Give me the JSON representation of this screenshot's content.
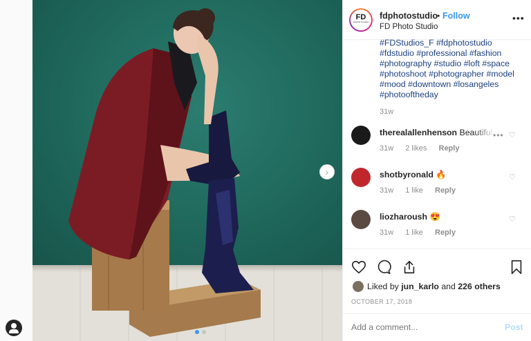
{
  "post": {
    "username": "fdphotostudio",
    "separator": "•",
    "follow_label": "Follow",
    "full_name": "FD Photo Studio",
    "logo_text": "FD",
    "logo_sub": "PHOTO STUDIO",
    "more_label": "•••",
    "caption_lines": [
      "#FDStudios_F #fdphotostudio",
      "#fdstudio #professional #fashion",
      "#photography #studio #loft #space",
      "#photoshoot #photographer #model",
      "#mood #downtown #losangeles",
      "#photooftheday"
    ],
    "caption_time": "31w",
    "next_arrow": "›"
  },
  "comments": [
    {
      "user": "therealallenhenson",
      "text": "Beautiful",
      "time": "31w",
      "likes": "2 likes",
      "reply": "Reply"
    },
    {
      "user": "shotbyronald",
      "text": "🔥",
      "time": "31w",
      "likes": "1 like",
      "reply": "Reply"
    },
    {
      "user": "liozharoush",
      "text": "😍",
      "time": "31w",
      "likes": "1 like",
      "reply": "Reply"
    }
  ],
  "actions": {
    "liked_by_prefix": "Liked by",
    "liked_by_user": "jun_karlo",
    "and": "and",
    "others": "226 others",
    "date": "OCTOBER 17, 2018",
    "add_comment_placeholder": "Add a comment...",
    "post_label": "Post"
  },
  "comment_more": "•••",
  "heart_glyph": "♡",
  "colors": {
    "accent": "#3897f0",
    "post_disabled": "#b3dbff",
    "hashtag": "#1b3f80",
    "wall": "#206a5f",
    "coat": "#7b1c24"
  },
  "icons": [
    "heart-icon",
    "comment-icon",
    "share-icon",
    "bookmark-icon",
    "user-icon",
    "chevron-right-icon",
    "more-icon"
  ]
}
